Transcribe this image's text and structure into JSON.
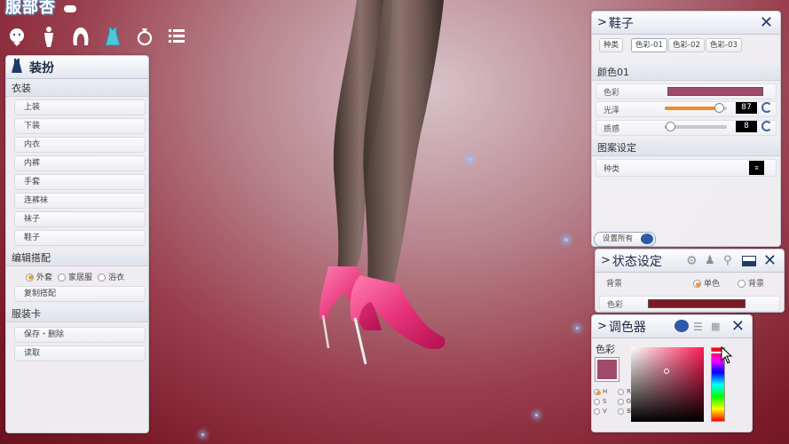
{
  "app": {
    "title": "服部杏"
  },
  "colors": {
    "accent": "#f08a2c",
    "shoe_color": "#a24a6a",
    "panel_title": "#1d2a44"
  },
  "topbar": {
    "icons": [
      "face-icon",
      "body-icon",
      "hair-icon",
      "outfit-icon",
      "accessory-icon",
      "list-icon"
    ]
  },
  "left_panel": {
    "title": "装扮",
    "sections": {
      "clothing": {
        "label": "衣装",
        "items": [
          "上装",
          "下装",
          "内衣",
          "内裤",
          "手套",
          "连裤袜",
          "袜子",
          "鞋子"
        ]
      },
      "outfit_edit": {
        "label": "编辑搭配",
        "options": [
          "外套",
          "家居服",
          "浴衣"
        ],
        "selected": "外套",
        "copy": "复制搭配"
      },
      "card": {
        "label": "服装卡",
        "save_delete": "保存・删除",
        "load": "读取"
      }
    }
  },
  "shoe_panel": {
    "title": "鞋子",
    "tabs": [
      "种类",
      "色彩-01",
      "色彩-02",
      "色彩-03"
    ],
    "active_tab": "色彩-01",
    "color_section": "颜色01",
    "color_label": "色彩",
    "gloss_label": "光泽",
    "gloss_value": "87",
    "gloss_fraction": 0.87,
    "texture_label": "质感",
    "texture_value": "8",
    "texture_fraction": 0.08,
    "pattern_section": "图案设定",
    "pattern_label": "种类",
    "set_all": "设置所有"
  },
  "status_panel": {
    "title": "状态设定",
    "background_label": "背景",
    "options": [
      "单色",
      "背景"
    ],
    "selected": "单色",
    "color_label": "色彩",
    "bg_color": "#7a1a28"
  },
  "picker_panel": {
    "title": "调色器",
    "color_label": "色彩",
    "modes": [
      "H",
      "R",
      "S",
      "G",
      "V",
      "B"
    ],
    "selected_mode": "H",
    "current_color": "#a24a6a"
  }
}
